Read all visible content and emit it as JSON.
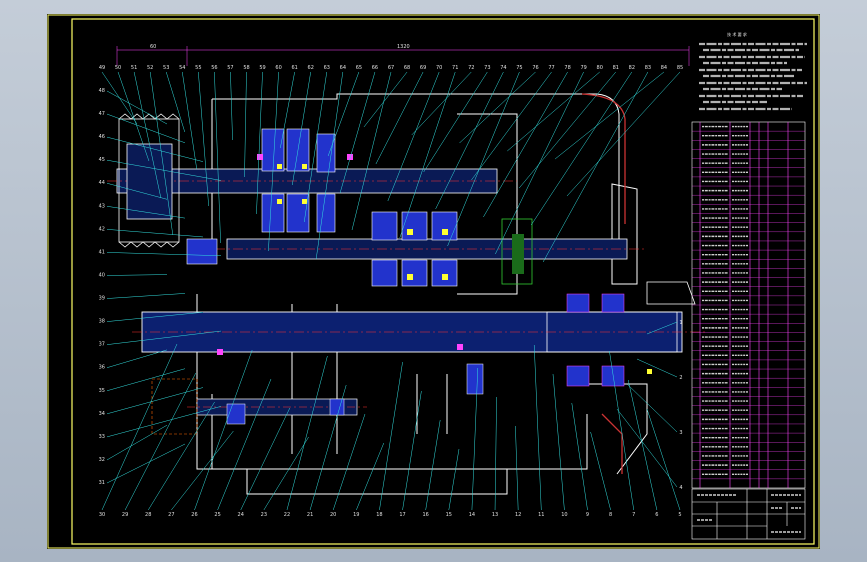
{
  "drawing": {
    "dimensions": {
      "left": "60",
      "overall": "1320"
    },
    "notes_title": "技 术 要 求",
    "top_callouts": [
      "49",
      "50",
      "51",
      "52",
      "53",
      "54",
      "55",
      "56",
      "57",
      "58",
      "59",
      "60",
      "61",
      "62",
      "63",
      "64",
      "65",
      "66",
      "67",
      "68",
      "69",
      "70",
      "71",
      "72",
      "73",
      "74",
      "75",
      "76",
      "77",
      "78",
      "79",
      "80",
      "81",
      "82",
      "83",
      "84",
      "85"
    ],
    "left_callouts": [
      "48",
      "47",
      "46",
      "45",
      "44",
      "43",
      "42",
      "41",
      "40",
      "39",
      "38",
      "37",
      "36",
      "35",
      "34",
      "33",
      "32",
      "31"
    ],
    "bottom_callouts": [
      "30",
      "29",
      "28",
      "27",
      "26",
      "25",
      "24",
      "23",
      "22",
      "21",
      "20",
      "19",
      "18",
      "17",
      "16",
      "15",
      "14",
      "13",
      "12",
      "11",
      "10",
      "9",
      "8",
      "7",
      "6",
      "5"
    ],
    "right_callouts": [
      "1",
      "2",
      "3",
      "4"
    ]
  },
  "colors": {
    "background": "#000000",
    "frame": "#ffff66",
    "outline": "#ffffff",
    "leader": "#33e0e0",
    "centerline": "#ff3333",
    "hatch": "#3344ff",
    "accent": "#ff44ff",
    "green": "#33cc33"
  }
}
